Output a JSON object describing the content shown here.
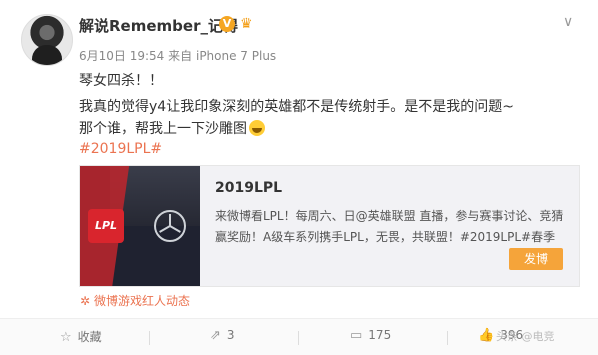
{
  "post": {
    "author": "解说Remember_记得",
    "date": "6月10日 19:54",
    "source_prefix": "来自",
    "device": "iPhone 7 Plus",
    "lines": [
      "琴女四杀！！",
      "我真的觉得y4让我印象深刻的英雄都不是传统射手。是不是我的问题~",
      "那个谁，帮我上一下沙雕图"
    ],
    "hashtag": "#2019LPL#"
  },
  "card": {
    "title": "2019LPL",
    "description": "来微博看LPL！每周六、日@英雄联盟 直播，参与赛事讨论、竞猜赢奖励！A级车系列携手LPL，无畏，共联盟！#2019LPL#春季",
    "logo_text": "LPL",
    "button": "发博"
  },
  "source_tag": "微博游戏红人动态",
  "actions": {
    "favorite": "收藏",
    "repost": "3",
    "comment": "175",
    "like": "396"
  },
  "watermark": "头条 @电竞",
  "icons": {
    "verified": "v-verified-icon",
    "vip": "vip-icon",
    "menu": "chevron-down-icon",
    "favorite": "star-icon",
    "repost": "share-icon",
    "comment": "comment-icon",
    "like": "thumbs-up-icon",
    "source": "flower-icon"
  },
  "colors": {
    "accent": "#eb7350",
    "button": "#f5a43a",
    "verified": "#f5a623"
  }
}
